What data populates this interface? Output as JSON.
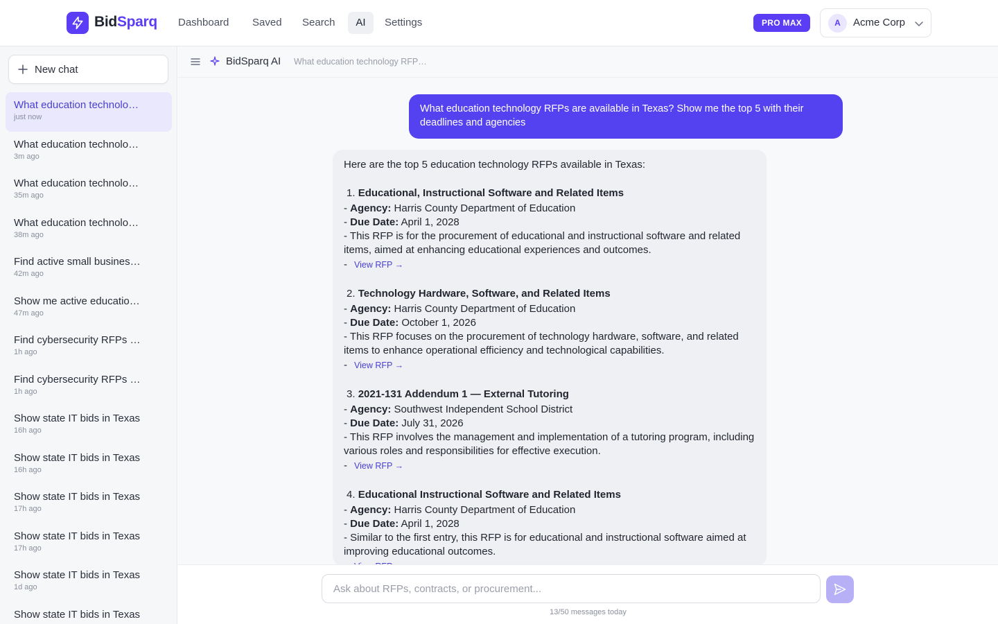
{
  "brand": {
    "part1": "Bid",
    "part2": "Sparq",
    "accent": "#5b3df5"
  },
  "nav": {
    "items": [
      "Dashboard",
      "Saved",
      "Search",
      "AI",
      "Settings"
    ],
    "active": "AI"
  },
  "plan_badge": "PRO MAX",
  "org": {
    "initial": "A",
    "name": "Acme Corp"
  },
  "sidebar": {
    "new_chat": "New chat",
    "chats": [
      {
        "title": "What education technolo…",
        "time": "just now"
      },
      {
        "title": "What education technolo…",
        "time": "3m ago"
      },
      {
        "title": "What education technolo…",
        "time": "35m ago"
      },
      {
        "title": "What education technolo…",
        "time": "38m ago"
      },
      {
        "title": "Find active small busines…",
        "time": "42m ago"
      },
      {
        "title": "Show me active educatio…",
        "time": "47m ago"
      },
      {
        "title": "Find cybersecurity RFPs d…",
        "time": "1h ago"
      },
      {
        "title": "Find cybersecurity RFPs d…",
        "time": "1h ago"
      },
      {
        "title": "Show state IT bids in Texas",
        "time": "16h ago"
      },
      {
        "title": "Show state IT bids in Texas",
        "time": "16h ago"
      },
      {
        "title": "Show state IT bids in Texas",
        "time": "17h ago"
      },
      {
        "title": "Show state IT bids in Texas",
        "time": "17h ago"
      },
      {
        "title": "Show state IT bids in Texas",
        "time": "1d ago"
      },
      {
        "title": "Show state IT bids in Texas",
        "time": ""
      }
    ]
  },
  "chat": {
    "title": "BidSparq AI",
    "crumb": "What education technology RFP…",
    "user_message": "What education technology RFPs are available in Texas? Show me the top 5 with their deadlines and agencies",
    "ai_intro": "Here are the top 5 education technology RFPs available in Texas:",
    "labels": {
      "agency": "Agency:",
      "due": "Due Date:",
      "view": "View RFP →",
      "dash": "-"
    },
    "rfps": [
      {
        "num": "1.",
        "title": "Educational, Instructional Software and Related Items",
        "agency": "Harris County Department of Education",
        "due": "April 1, 2028",
        "desc": "This RFP is for the procurement of educational and instructional software and related items, aimed at enhancing educational experiences and outcomes."
      },
      {
        "num": "2.",
        "title": "Technology Hardware, Software, and Related Items",
        "agency": "Harris County Department of Education",
        "due": "October 1, 2026",
        "desc": "This RFP focuses on the procurement of technology hardware, software, and related items to enhance operational efficiency and technological capabilities."
      },
      {
        "num": "3.",
        "title": "2021-131 Addendum 1 — External Tutoring",
        "agency": "Southwest Independent School District",
        "due": "July 31, 2026",
        "desc": "This RFP involves the management and implementation of a tutoring program, including various roles and responsibilities for effective execution."
      },
      {
        "num": "4.",
        "title": "Educational Instructional Software and Related Items",
        "agency": "Harris County Department of Education",
        "due": "April 1, 2028",
        "desc": "Similar to the first entry, this RFP is for educational and instructional software aimed at improving educational outcomes."
      }
    ],
    "input_placeholder": "Ask about RFPs, contracts, or procurement...",
    "quota": "13/50 messages today"
  }
}
